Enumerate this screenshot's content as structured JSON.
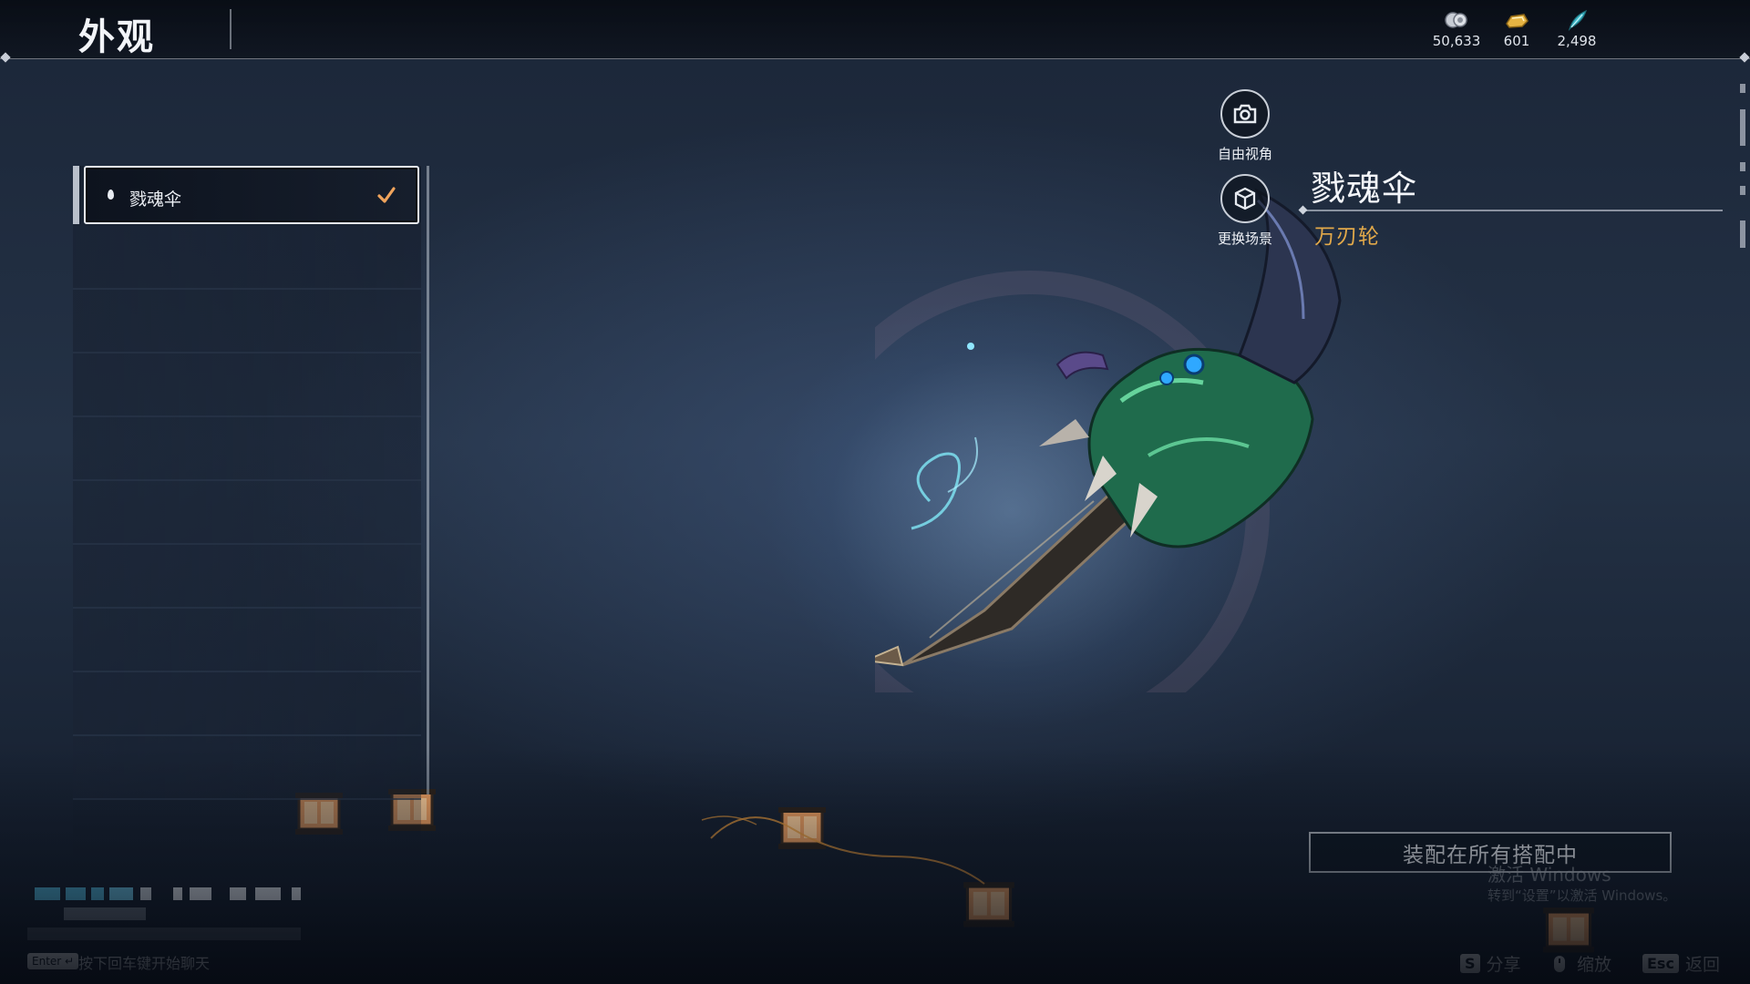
{
  "header": {
    "title": "外观",
    "currencies": [
      {
        "icon": "silver-coin-icon",
        "value": "50,633"
      },
      {
        "icon": "gold-ingot-icon",
        "value": "601"
      },
      {
        "icon": "jade-feather-icon",
        "value": "2,498"
      }
    ]
  },
  "list": {
    "items": [
      {
        "label": "戮魂伞",
        "selected": true
      }
    ]
  },
  "camera": {
    "free_view_label": "自由视角",
    "change_scene_label": "更换场景"
  },
  "item": {
    "name": "戮魂伞",
    "type": "万刃轮"
  },
  "actions": {
    "equip_all_label": "装配在所有搭配中"
  },
  "watermark": {
    "line1": "激活 Windows",
    "line2": "转到“设置”以激活 Windows。"
  },
  "chat": {
    "key": "Enter",
    "hint": "按下回车键开始聊天"
  },
  "hints": [
    {
      "key": "S",
      "label": "分享"
    },
    {
      "key": "",
      "icon": "mouse-icon",
      "label": "缩放"
    },
    {
      "key": "Esc",
      "label": "返回"
    }
  ],
  "colors": {
    "accent_gold": "#e2a94a",
    "check_orange": "#f0a45c"
  }
}
